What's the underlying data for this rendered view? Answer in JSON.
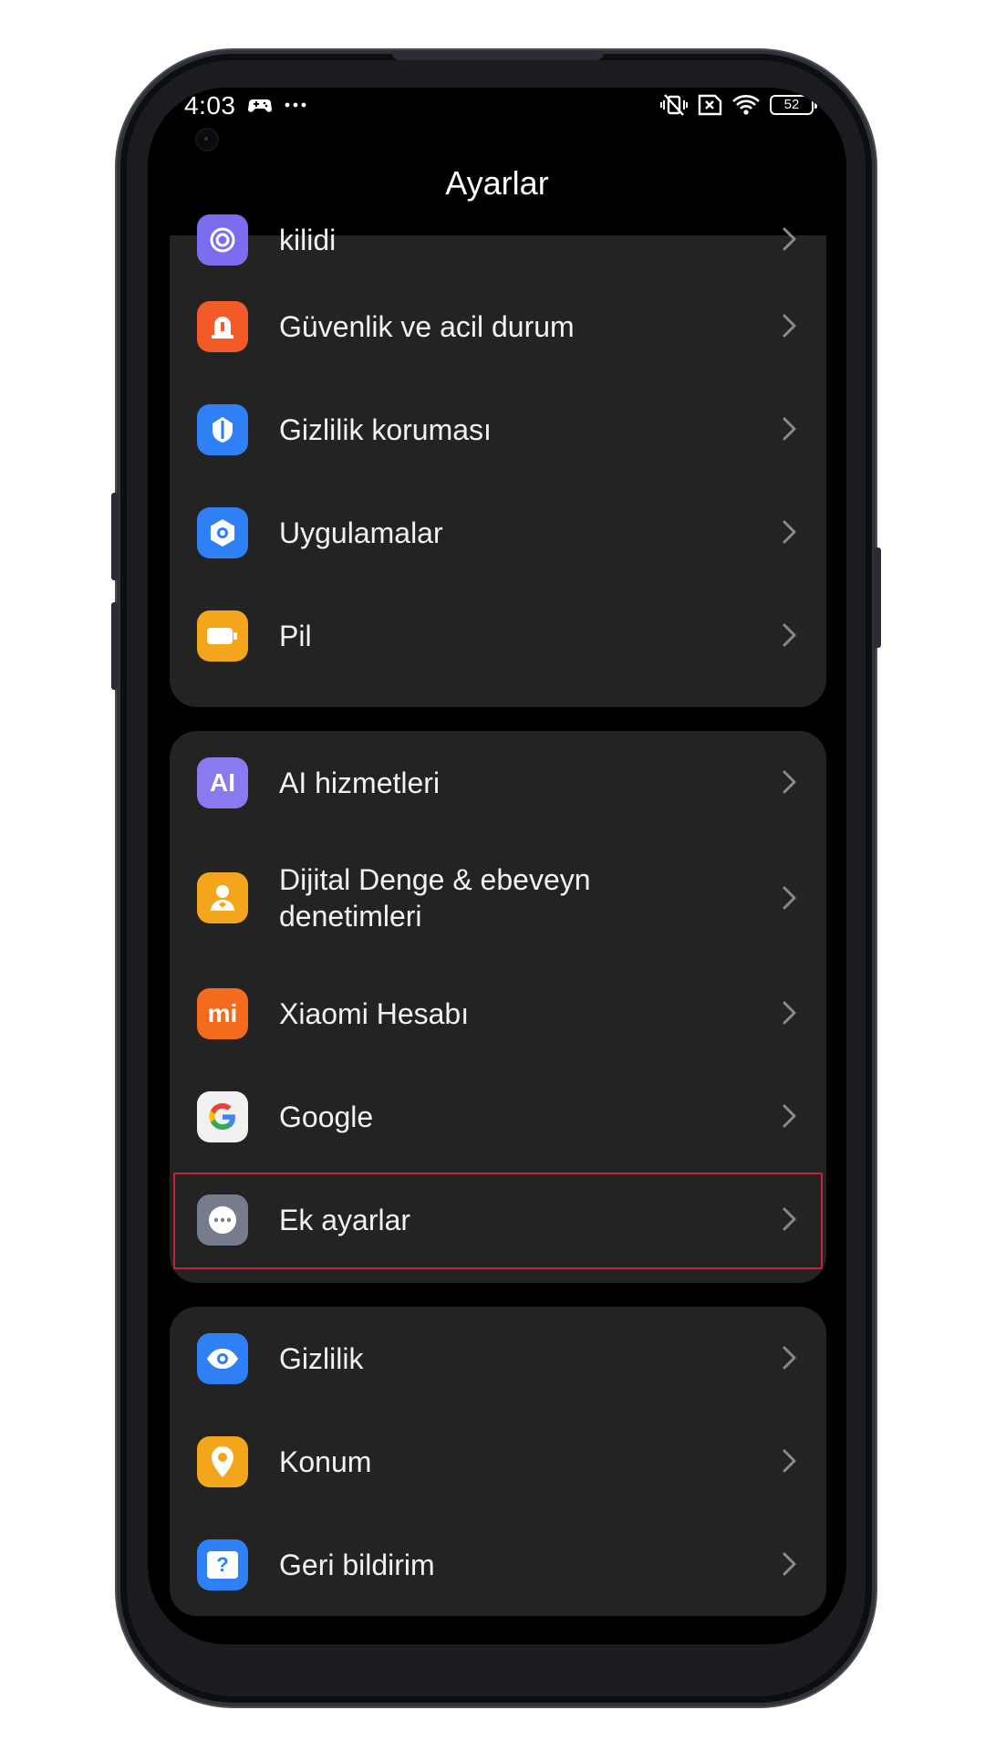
{
  "status_bar": {
    "time": "4:03",
    "left_icons": [
      "game-controller-icon",
      "more-dots-icon"
    ],
    "right_icons": [
      "vibrate-off-icon",
      "sim-error-icon",
      "wifi-icon"
    ],
    "battery": "52"
  },
  "header": {
    "title": "Ayarlar"
  },
  "groups": [
    {
      "items": [
        {
          "label": "kilidi",
          "icon": "fingerprint-icon",
          "color": "#7b6cf0"
        },
        {
          "label": "Güvenlik ve acil durum",
          "icon": "emergency-bell-icon",
          "color": "#f25a27"
        },
        {
          "label": "Gizlilik koruması",
          "icon": "privacy-shield-icon",
          "color": "#2f7ff5"
        },
        {
          "label": "Uygulamalar",
          "icon": "apps-gear-icon",
          "color": "#2f7ff5"
        },
        {
          "label": "Pil",
          "icon": "battery-icon",
          "color": "#f3a51b"
        }
      ]
    },
    {
      "items": [
        {
          "label": "AI hizmetleri",
          "icon": "ai-icon",
          "icon_text": "AI",
          "color": "#8a7af0"
        },
        {
          "label": "Dijital Denge & ebeveyn denetimleri",
          "icon": "parental-person-icon",
          "color": "#f3a51b"
        },
        {
          "label": "Xiaomi Hesabı",
          "icon": "mi-logo-icon",
          "icon_text": "mi",
          "color": "#f46b1e"
        },
        {
          "label": "Google",
          "icon": "google-g-icon",
          "icon_text": "G",
          "color": "#f1f1f1"
        },
        {
          "label": "Ek ayarlar",
          "icon": "more-settings-icon",
          "color": "#767c8c",
          "highlighted": true
        }
      ]
    },
    {
      "items": [
        {
          "label": "Gizlilik",
          "icon": "eye-icon",
          "color": "#2f7ff5"
        },
        {
          "label": "Konum",
          "icon": "location-pin-icon",
          "color": "#f3a51b"
        },
        {
          "label": "Geri bildirim",
          "icon": "feedback-question-icon",
          "icon_text": "?",
          "color": "#2f7ff5"
        }
      ]
    }
  ]
}
